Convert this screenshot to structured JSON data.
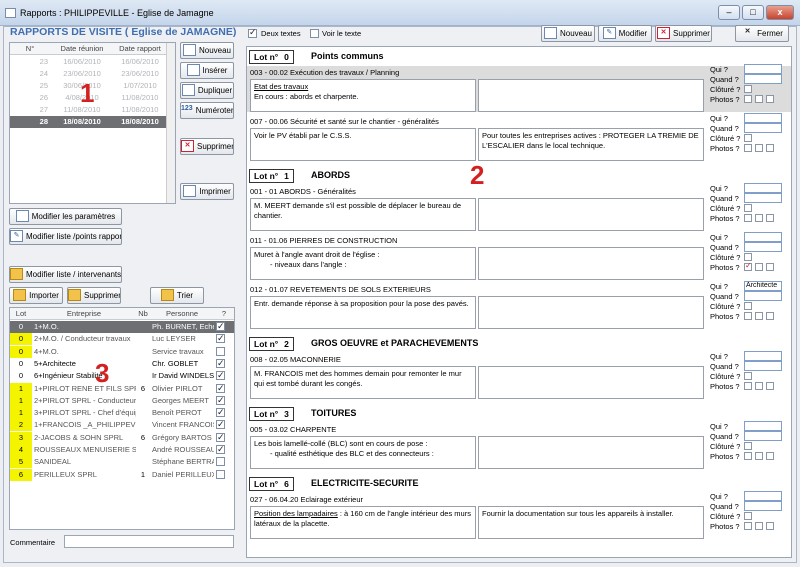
{
  "window": {
    "title": "Rapports  :  PHILIPPEVILLE  -  Eglise de Jamagne",
    "min": "–",
    "max": "□",
    "close": "x"
  },
  "header_title": "RAPPORTS DE VISITE ( Eglise de JAMAGNE)",
  "toggles": {
    "deux_textes": "Deux textes",
    "deux_textes_checked": true,
    "voir_texte": "Voir le texte",
    "voir_texte_checked": false
  },
  "top_buttons": {
    "nouveau": "Nouveau",
    "modifier": "Modifier",
    "supprimer": "Supprimer",
    "fermer": "Fermer"
  },
  "reports_table": {
    "headers": [
      "N°",
      "Date réunion",
      "Date rapport"
    ],
    "rows": [
      {
        "n": "23",
        "reunion": "16/06/2010",
        "rapport": "16/06/2010",
        "style": "grey"
      },
      {
        "n": "24",
        "reunion": "23/06/2010",
        "rapport": "23/06/2010",
        "style": "grey"
      },
      {
        "n": "25",
        "reunion": "30/06/2010",
        "rapport": "1/07/2010",
        "style": "grey"
      },
      {
        "n": "26",
        "reunion": "4/08/2010",
        "rapport": "11/08/2010",
        "style": "grey"
      },
      {
        "n": "27",
        "reunion": "11/08/2010",
        "rapport": "11/08/2010",
        "style": "grey"
      },
      {
        "n": "28",
        "reunion": "18/08/2010",
        "rapport": "18/08/2010",
        "style": "selected"
      }
    ]
  },
  "side_buttons": {
    "nouveau": "Nouveau",
    "inserer": "Insérer",
    "dupliquer": "Dupliquer",
    "numeroter": "Numéroter",
    "numeroter_icon": "123",
    "supprimer": "Supprimer",
    "imprimer": "Imprimer"
  },
  "param_buttons": {
    "modifier_parametres": "Modifier les paramètres",
    "modifier_liste_points": "Modifier liste /points rapport",
    "modifier_liste_intervenants": "Modifier liste / intervenants",
    "importer": "Importer",
    "supprimer": "Supprimer",
    "trier": "Trier"
  },
  "annotations": {
    "one": "1",
    "two": "2",
    "three": "3"
  },
  "contacts_table": {
    "headers": [
      "Lot",
      "Entreprise",
      "Nb",
      "Personne",
      "?"
    ],
    "rows": [
      {
        "lot": "0",
        "entreprise": "1+M.O.",
        "nb": "",
        "personne": "Ph. BURNET, Echevin",
        "checked": true,
        "lotcolor": "#e8e8e8",
        "selected": true
      },
      {
        "lot": "0",
        "entreprise": "2+M.O. / Conducteur travaux",
        "nb": "",
        "personne": "Luc LEYSER",
        "checked": true,
        "lotcolor": "#f4f400"
      },
      {
        "lot": "0",
        "entreprise": "4+M.O.",
        "nb": "",
        "personne": "Service travaux",
        "checked": false,
        "lotcolor": "#f4f400"
      },
      {
        "lot": "0",
        "entreprise": "5+Architecte",
        "nb": "",
        "personne": "Chr. GOBLET",
        "checked": true,
        "lotcolor": "#ffffff"
      },
      {
        "lot": "0",
        "entreprise": "6+Ingénieur Stabilité",
        "nb": "",
        "personne": "Ir David WINDELS",
        "checked": true,
        "lotcolor": "#ffffff"
      },
      {
        "lot": "1",
        "entreprise": "1+PIRLOT RENE ET FILS SPRL",
        "nb": "6",
        "personne": "Olivier PIRLOT",
        "checked": true,
        "lotcolor": "#f4f400"
      },
      {
        "lot": "1",
        "entreprise": "2+PIRLOT SPRL - Conducteur",
        "nb": "",
        "personne": "Georges MEERT",
        "checked": true,
        "lotcolor": "#f4f400"
      },
      {
        "lot": "1",
        "entreprise": "3+PIRLOT SPRL - Chef d'équipe",
        "nb": "",
        "personne": "Benoît PEROT",
        "checked": true,
        "lotcolor": "#f4f400"
      },
      {
        "lot": "2",
        "entreprise": "1+FRANCOIS _A_PHILIPPEVILLE",
        "nb": "",
        "personne": "Vincent FRANCOIS",
        "checked": true,
        "lotcolor": "#f4f400"
      },
      {
        "lot": "3",
        "entreprise": "2-JACOBS & SOHN SPRL",
        "nb": "6",
        "personne": "Grégory BARTOS",
        "checked": true,
        "lotcolor": "#f4f400"
      },
      {
        "lot": "4",
        "entreprise": "ROUSSEAUX MENUISERIE SPRL",
        "nb": "",
        "personne": "André ROUSSEAUX",
        "checked": true,
        "lotcolor": "#f4f400"
      },
      {
        "lot": "5",
        "entreprise": "SANIDEAL",
        "nb": "",
        "personne": "Stéphane BERTRAND",
        "checked": false,
        "lotcolor": "#f4f400"
      },
      {
        "lot": "6",
        "entreprise": "PERILLEUX SPRL",
        "nb": "1",
        "personne": "Daniel PERILLEUX",
        "checked": false,
        "lotcolor": "#f4f400"
      }
    ]
  },
  "commentaire_label": "Commentaire",
  "commentaire_value": "",
  "report": {
    "lot_prefix": "Lot n°",
    "q_labels": {
      "qui": "Qui ?",
      "quand": "Quand ?",
      "cloture": "Clôturé ?",
      "photos": "Photos ?"
    },
    "sections": [
      {
        "lot": "0",
        "title": "Points communs",
        "items": [
          {
            "code": "003 - 00.02 Exécution des travaux / Planning",
            "left_u": "Etat des travaux",
            "left": "En cours : abords et charpente.",
            "right": "",
            "qui": "",
            "shaded": true
          },
          {
            "code": "007 - 00.06 Sécurité et santé sur le chantier - généralités",
            "left_u": "",
            "left": "Voir le PV établi par le C.S.S.",
            "right": "Pour toutes les entreprises actives : PROTEGER LA TREMIE DE L'ESCALIER dans le local technique.",
            "qui": ""
          }
        ]
      },
      {
        "lot": "1",
        "title": "ABORDS",
        "items": [
          {
            "code": "001 - 01 ABORDS - Généralités",
            "left_u": "",
            "left": "M. MEERT demande s'il est possible de déplacer le bureau de chantier.",
            "right": "",
            "qui": ""
          },
          {
            "code": "011 - 01.06 PIERRES DE CONSTRUCTION",
            "left_u": "",
            "left": "Muret à l'angle avant droit de l'église :",
            "left2": "-       niveaux dans l'angle :",
            "right": "",
            "qui": "",
            "photo_checked": true
          },
          {
            "code": "012 - 01.07 REVETEMENTS DE SOLS EXTERIEURS",
            "left_u": "",
            "left": "Entr. demande réponse à sa proposition pour la pose des pavés.",
            "right": "",
            "qui": "Architecte"
          }
        ]
      },
      {
        "lot": "2",
        "title": "GROS OEUVRE et PARACHEVEMENTS",
        "items": [
          {
            "code": "008 - 02.05 MACONNERIE",
            "left_u": "",
            "left": "M. FRANCOIS met des hommes demain pour remonter le mur qui est tombé durant les congés.",
            "right": "",
            "qui": ""
          }
        ]
      },
      {
        "lot": "3",
        "title": "TOITURES",
        "items": [
          {
            "code": "005 - 03.02 CHARPENTE",
            "left_u": "",
            "left": "Les bois lamellé-collé (BLC) sont en cours de pose :",
            "left2": "-       qualité esthétique des BLC et des connecteurs :",
            "right": "",
            "qui": ""
          }
        ]
      },
      {
        "lot": "6",
        "title": "ELECTRICITE-SECURITE",
        "items": [
          {
            "code": "027 - 06.04.20 Eclairage extérieur",
            "left_u": "Position des lampadaires",
            "left": " : à 160 cm de l'angle intérieur des murs latéraux de la placette.",
            "right": "Fournir la documentation sur tous les appareils à installer.",
            "qui": ""
          }
        ]
      }
    ]
  }
}
